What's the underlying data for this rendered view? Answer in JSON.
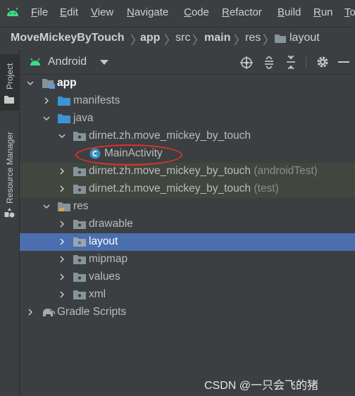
{
  "menu": {
    "items": [
      {
        "label": "File",
        "mn": "F",
        "rest": "ile"
      },
      {
        "label": "Edit",
        "mn": "E",
        "rest": "dit"
      },
      {
        "label": "View",
        "mn": "V",
        "rest": "iew"
      },
      {
        "label": "Navigate",
        "mn": "N",
        "rest": "avigate"
      },
      {
        "label": "Code",
        "mn": "C",
        "rest": "ode"
      },
      {
        "label": "Refactor",
        "mn": "R",
        "rest": "efactor"
      },
      {
        "label": "Build",
        "mn": "B",
        "rest": "uild"
      },
      {
        "label": "Run",
        "mn": "R",
        "rest": "un"
      },
      {
        "label": "To",
        "mn": "T",
        "rest": "o"
      }
    ]
  },
  "breadcrumb": [
    "MoveMickeyByTouch",
    "app",
    "src",
    "main",
    "res",
    "layout"
  ],
  "side_tabs": {
    "project": "Project",
    "resource_manager": "Resource Manager"
  },
  "toolbar": {
    "view_selector": "Android"
  },
  "tree": [
    {
      "label": "app",
      "suffix": ""
    },
    {
      "label": "manifests",
      "suffix": ""
    },
    {
      "label": "java",
      "suffix": ""
    },
    {
      "label": "dirnet.zh.move_mickey_by_touch",
      "suffix": ""
    },
    {
      "label": "MainActivity",
      "suffix": ""
    },
    {
      "label": "dirnet.zh.move_mickey_by_touch",
      "suffix": "(androidTest)"
    },
    {
      "label": "dirnet.zh.move_mickey_by_touch",
      "suffix": "(test)"
    },
    {
      "label": "res",
      "suffix": ""
    },
    {
      "label": "drawable",
      "suffix": ""
    },
    {
      "label": "layout",
      "suffix": ""
    },
    {
      "label": "mipmap",
      "suffix": ""
    },
    {
      "label": "values",
      "suffix": ""
    },
    {
      "label": "xml",
      "suffix": ""
    },
    {
      "label": "Gradle Scripts",
      "suffix": ""
    }
  ],
  "watermark": "CSDN @一只会飞的猪",
  "colors": {
    "background": "#3c3f41",
    "selection": "#4b6eaf",
    "test_row": "#41473f",
    "annotation": "#e0302c",
    "folder": "#87939a",
    "java_folder": "#3a95d4"
  }
}
